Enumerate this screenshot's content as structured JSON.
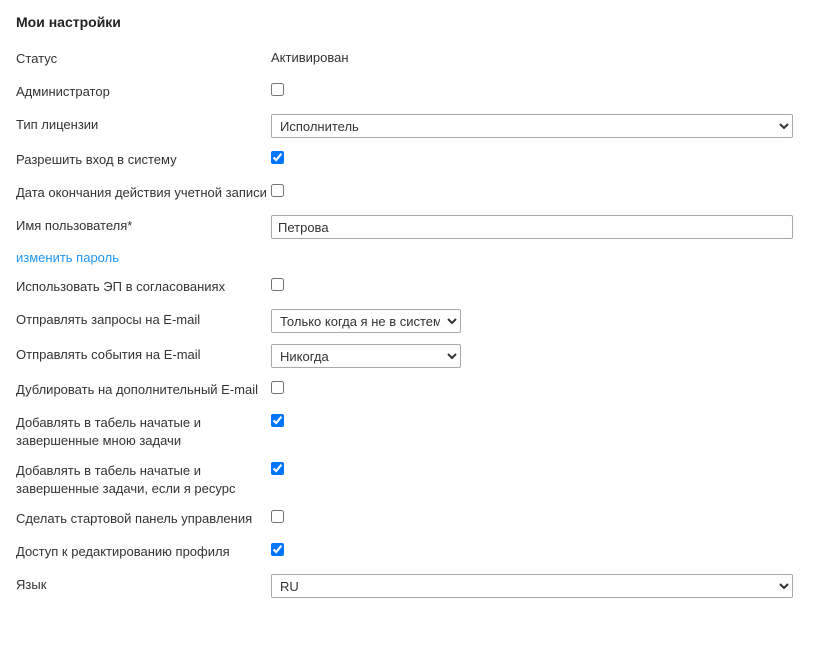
{
  "page_title": "Мои настройки",
  "fields": {
    "status": {
      "label": "Статус",
      "value": "Активирован"
    },
    "administrator": {
      "label": "Администратор",
      "checked": false
    },
    "license_type": {
      "label": "Тип лицензии",
      "value": "Исполнитель"
    },
    "allow_login": {
      "label": "Разрешить вход в систему",
      "checked": true
    },
    "account_expiry": {
      "label": "Дата окончания действия учетной записи",
      "checked": false
    },
    "username": {
      "label": "Имя пользователя*",
      "value": "Петрова"
    },
    "change_password": {
      "label": "изменить пароль"
    },
    "use_ep": {
      "label": "Использовать ЭП в согласованиях",
      "checked": false
    },
    "send_requests_email": {
      "label": "Отправлять запросы на E-mail",
      "value": "Только когда я не в системе"
    },
    "send_events_email": {
      "label": "Отправлять события на E-mail",
      "value": "Никогда"
    },
    "duplicate_email": {
      "label": "Дублировать на дополнительный E-mail",
      "checked": false
    },
    "add_timesheet_my_tasks": {
      "label": "Добавлять в табель начатые и завершенные мною задачи",
      "checked": true
    },
    "add_timesheet_resource": {
      "label": "Добавлять в табель начатые и завершенные задачи, если я ресурс",
      "checked": true
    },
    "start_dashboard": {
      "label": "Сделать стартовой панель управления",
      "checked": false
    },
    "profile_edit_access": {
      "label": "Доступ к редактированию профиля",
      "checked": true
    },
    "language": {
      "label": "Язык",
      "value": "RU"
    }
  }
}
